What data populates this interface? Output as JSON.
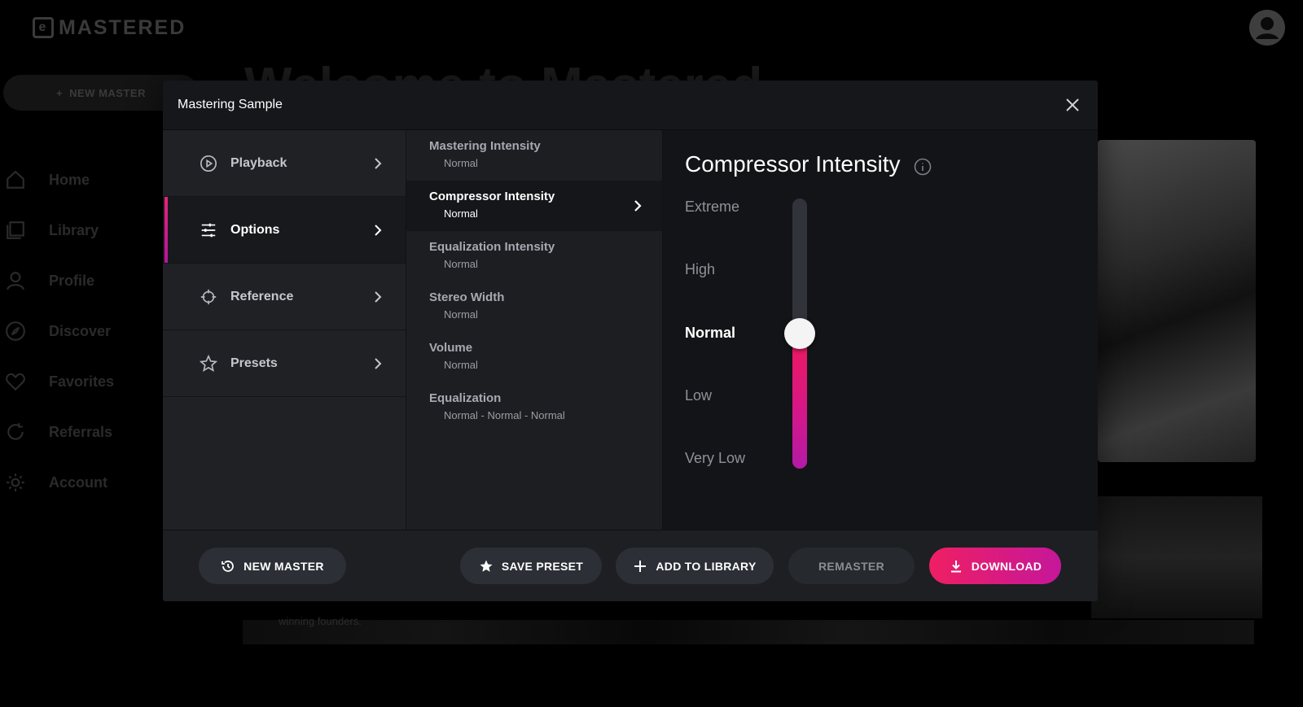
{
  "brand": {
    "name": "MASTERED",
    "mark": "e"
  },
  "background": {
    "new_master_label": "NEW MASTER",
    "heading": "Welcome to Mastered",
    "caption": "winning founders.",
    "nav": [
      {
        "label": "Home",
        "icon": "home-icon"
      },
      {
        "label": "Library",
        "icon": "library-icon"
      },
      {
        "label": "Profile",
        "icon": "profile-icon"
      },
      {
        "label": "Discover",
        "icon": "compass-icon"
      },
      {
        "label": "Favorites",
        "icon": "heart-icon"
      },
      {
        "label": "Referrals",
        "icon": "refresh-icon"
      },
      {
        "label": "Account",
        "icon": "gear-icon"
      }
    ]
  },
  "modal": {
    "title": "Mastering Sample",
    "left_menu": [
      {
        "label": "Playback",
        "icon": "play-circle-icon",
        "active": false
      },
      {
        "label": "Options",
        "icon": "sliders-icon",
        "active": true
      },
      {
        "label": "Reference",
        "icon": "crosshair-icon",
        "active": false
      },
      {
        "label": "Presets",
        "icon": "star-icon",
        "active": false
      }
    ],
    "options": [
      {
        "name": "Mastering Intensity",
        "value": "Normal"
      },
      {
        "name": "Compressor Intensity",
        "value": "Normal",
        "active": true
      },
      {
        "name": "Equalization Intensity",
        "value": "Normal"
      },
      {
        "name": "Stereo Width",
        "value": "Normal"
      },
      {
        "name": "Volume",
        "value": "Normal"
      },
      {
        "name": "Equalization",
        "value": "Normal - Normal - Normal"
      }
    ],
    "detail": {
      "title": "Compressor Intensity",
      "levels": [
        "Extreme",
        "High",
        "Normal",
        "Low",
        "Very Low"
      ],
      "selected": "Normal",
      "slider_level_fraction": 0.5
    },
    "footer": {
      "new_master": "NEW MASTER",
      "save_preset": "SAVE PRESET",
      "add_to_library": "ADD TO LIBRARY",
      "remaster": "REMASTER",
      "download": "DOWNLOAD"
    }
  },
  "colors": {
    "accent_start": "#ef1f63",
    "accent_end": "#c5179a",
    "modal_bg": "#16181b"
  }
}
